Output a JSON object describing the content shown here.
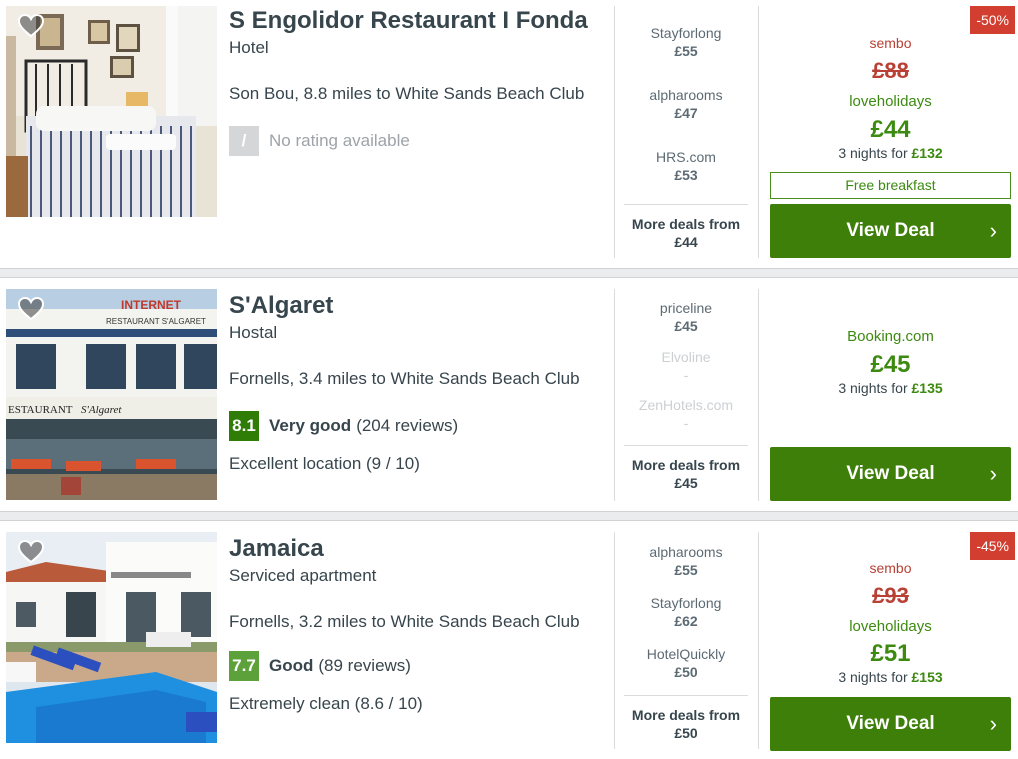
{
  "hotels": [
    {
      "name": "S Engolidor Restaurant I Fonda",
      "type": "Hotel",
      "location": "Son Bou, 8.8 miles to White Sands Beach Club",
      "rating": {
        "score": "/",
        "label": "",
        "reviews": "",
        "no_rating_text": "No rating available"
      },
      "extra": "",
      "deals": [
        {
          "provider": "Stayforlong",
          "price": "£55"
        },
        {
          "provider": "alpharooms",
          "price": "£47"
        },
        {
          "provider": "HRS.com",
          "price": "£53"
        }
      ],
      "more_deals_label": "More deals from",
      "more_deals_price": "£44",
      "discount": "-50%",
      "orig_provider": "sembo",
      "orig_price": "£88",
      "best_provider": "loveholidays",
      "best_price": "£44",
      "nights_text": "3 nights for",
      "nights_total": "£132",
      "perk": "Free breakfast",
      "cta": "View Deal"
    },
    {
      "name": "S'Algaret",
      "type": "Hostal",
      "location": "Fornells, 3.4 miles to White Sands Beach Club",
      "rating": {
        "score": "8.1",
        "label": "Very good",
        "reviews": "(204 reviews)"
      },
      "extra": "Excellent location (9 / 10)",
      "deals": [
        {
          "provider": "priceline",
          "price": "£45"
        },
        {
          "provider": "Elvoline",
          "price": "-"
        },
        {
          "provider": "ZenHotels.com",
          "price": "-"
        }
      ],
      "more_deals_label": "More deals from",
      "more_deals_price": "£45",
      "best_provider": "Booking.com",
      "best_price": "£45",
      "nights_text": "3 nights for",
      "nights_total": "£135",
      "cta": "View Deal"
    },
    {
      "name": "Jamaica",
      "type": "Serviced apartment",
      "location": "Fornells, 3.2 miles to White Sands Beach Club",
      "rating": {
        "score": "7.7",
        "label": "Good",
        "reviews": "(89 reviews)"
      },
      "extra": "Extremely clean (8.6 / 10)",
      "deals": [
        {
          "provider": "alpharooms",
          "price": "£55"
        },
        {
          "provider": "Stayforlong",
          "price": "£62"
        },
        {
          "provider": "HotelQuickly",
          "price": "£50"
        }
      ],
      "more_deals_label": "More deals from",
      "more_deals_price": "£50",
      "discount": "-45%",
      "orig_provider": "sembo",
      "orig_price": "£93",
      "best_provider": "loveholidays",
      "best_price": "£51",
      "nights_text": "3 nights for",
      "nights_total": "£153",
      "cta": "View Deal"
    }
  ],
  "icons": {
    "favorite": "heart-icon",
    "chevron": "chevron-right-icon"
  },
  "colors": {
    "deal_green": "#3d7f08",
    "discount_red": "#d23f30",
    "score_dark": "#2f7d07",
    "score_mid": "#5da13b"
  }
}
